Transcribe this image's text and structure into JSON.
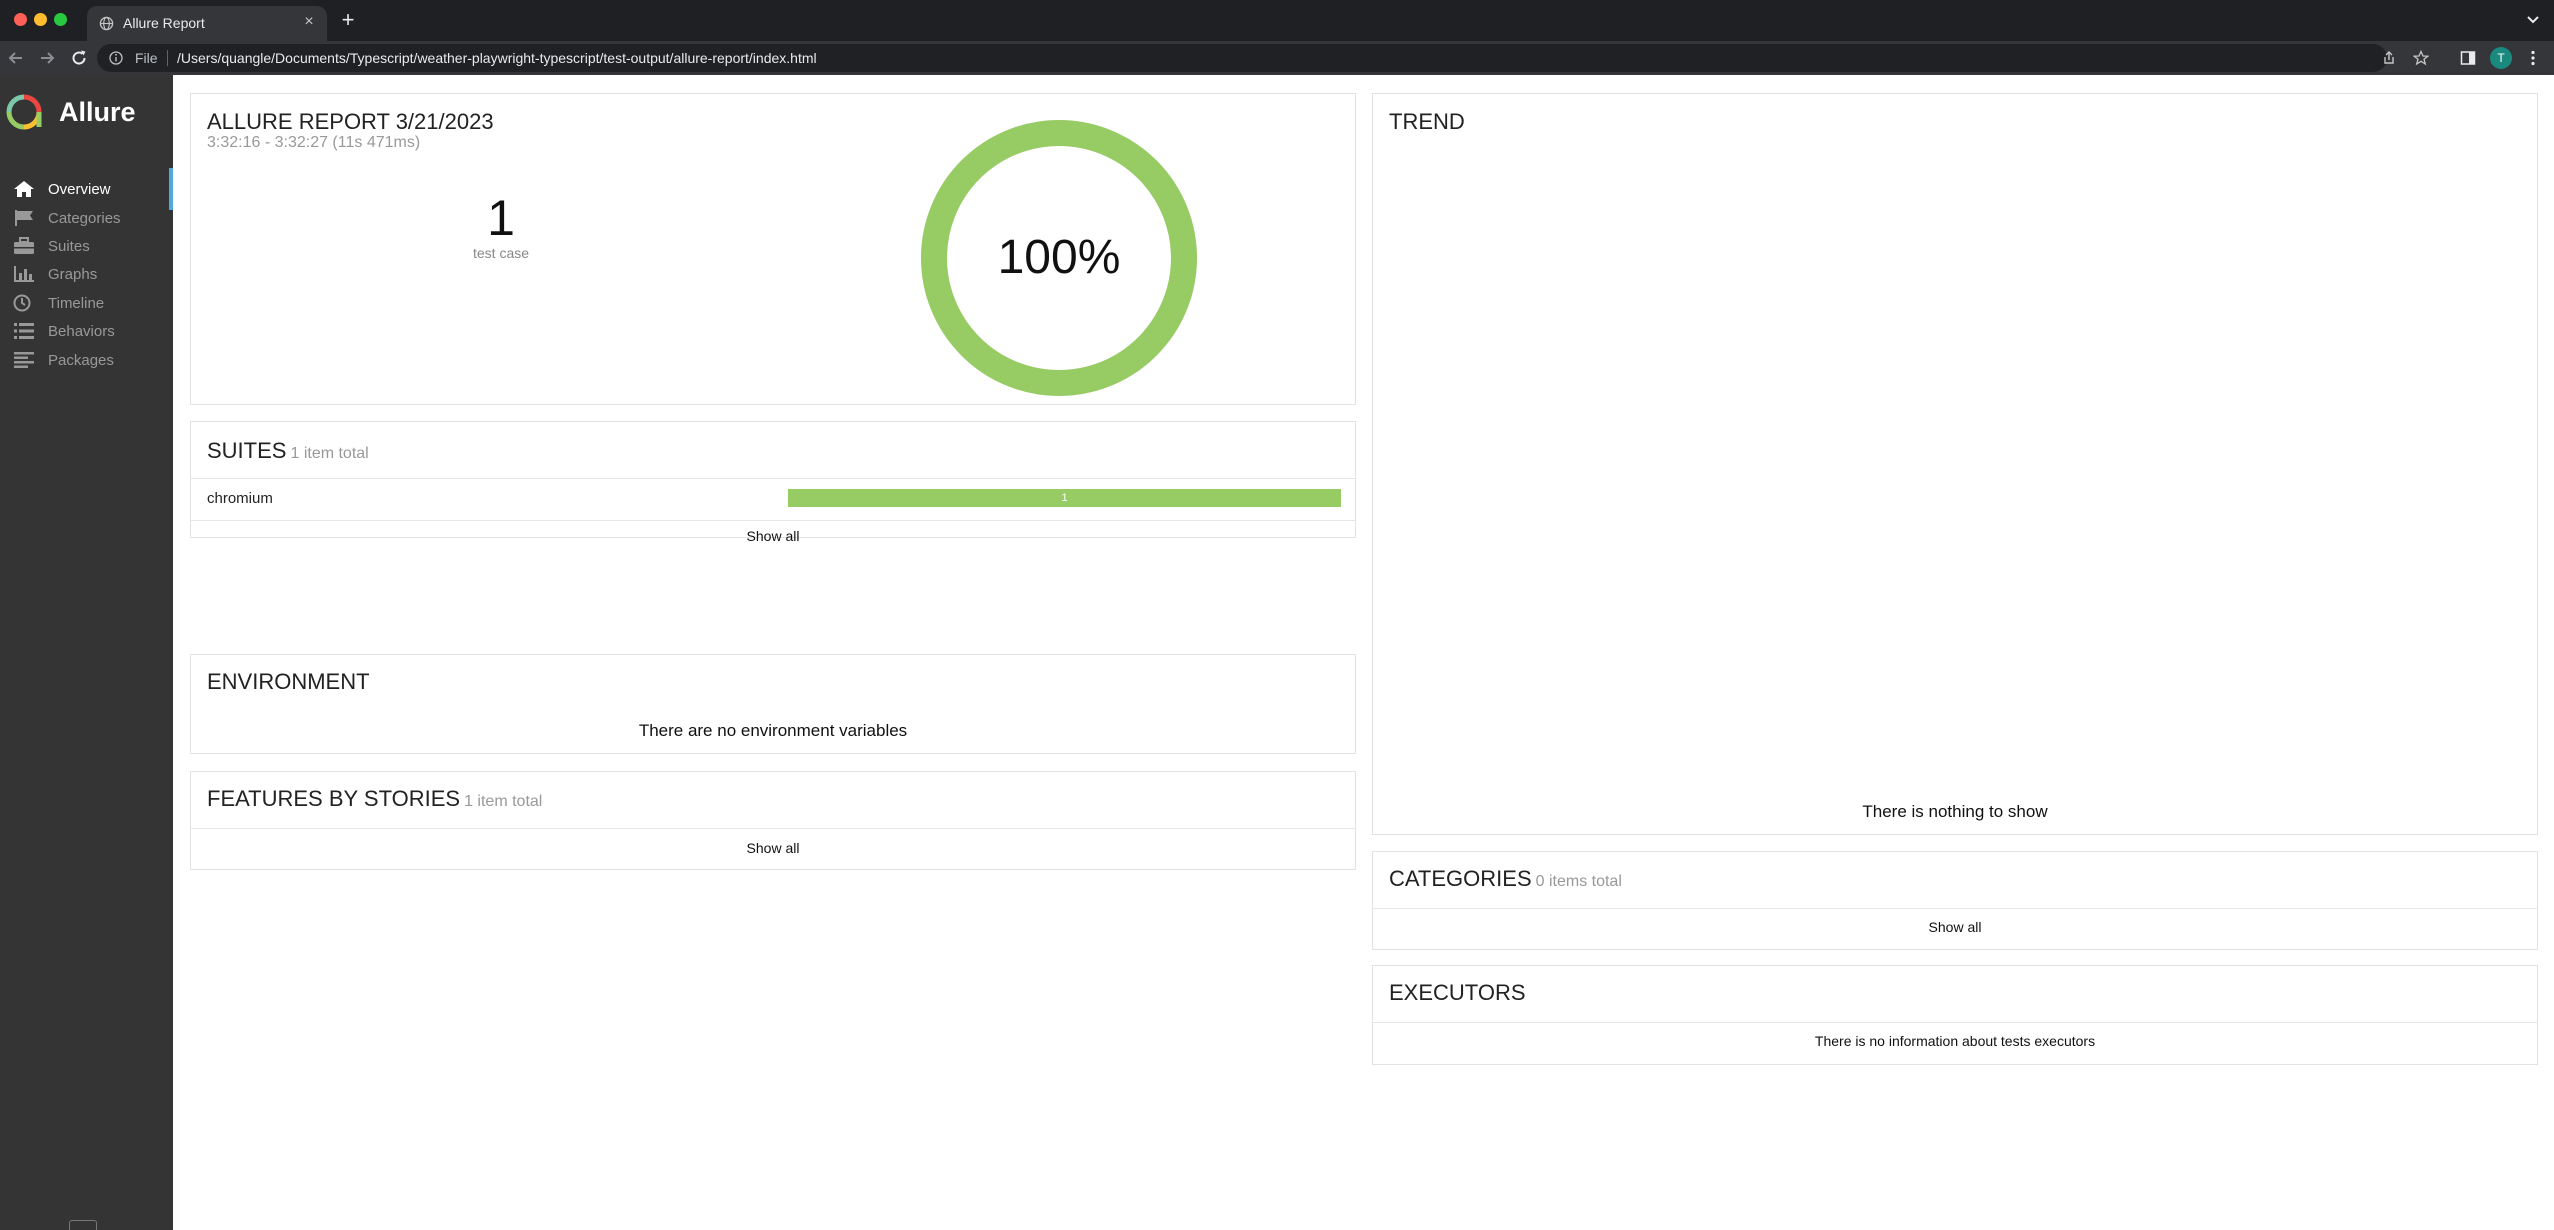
{
  "browser": {
    "tab_title": "Allure Report",
    "tab_close": "×",
    "new_tab": "+",
    "address_scheme": "File",
    "address_url": "/Users/quangle/Documents/Typescript/weather-playwright-typescript/test-output/allure-report/index.html",
    "profile_initial": "T"
  },
  "sidebar": {
    "brand": "Allure",
    "items": [
      {
        "label": "Overview",
        "icon": "home-icon",
        "active": true
      },
      {
        "label": "Categories",
        "icon": "flag-icon",
        "active": false
      },
      {
        "label": "Suites",
        "icon": "briefcase-icon",
        "active": false
      },
      {
        "label": "Graphs",
        "icon": "bar-chart-icon",
        "active": false
      },
      {
        "label": "Timeline",
        "icon": "clock-icon",
        "active": false
      },
      {
        "label": "Behaviors",
        "icon": "list-icon",
        "active": false
      },
      {
        "label": "Packages",
        "icon": "align-left-icon",
        "active": false
      }
    ]
  },
  "summary": {
    "title": "ALLURE REPORT 3/21/2023",
    "time_range": "3:32:16 - 3:32:27 (11s 471ms)",
    "test_count": "1",
    "test_count_label": "test case",
    "pass_percent_label": "100%",
    "pass_ratio": 1.0
  },
  "suites": {
    "title": "SUITES",
    "subtitle": "1 item total",
    "rows": [
      {
        "name": "chromium",
        "passed": "1"
      }
    ],
    "show_all": "Show all"
  },
  "environment": {
    "title": "ENVIRONMENT",
    "empty_text": "There are no environment variables"
  },
  "features": {
    "title": "FEATURES BY STORIES",
    "subtitle": "1 item total",
    "show_all": "Show all"
  },
  "trend": {
    "title": "TREND",
    "empty_text": "There is nothing to show"
  },
  "categories": {
    "title": "CATEGORIES",
    "subtitle": "0 items total",
    "show_all": "Show all"
  },
  "executors": {
    "title": "EXECUTORS",
    "empty_text": "There is no information about tests executors"
  },
  "colors": {
    "passed": "#97cc64",
    "sidebar_bg": "#343434",
    "active_marker": "#4fa8de"
  }
}
